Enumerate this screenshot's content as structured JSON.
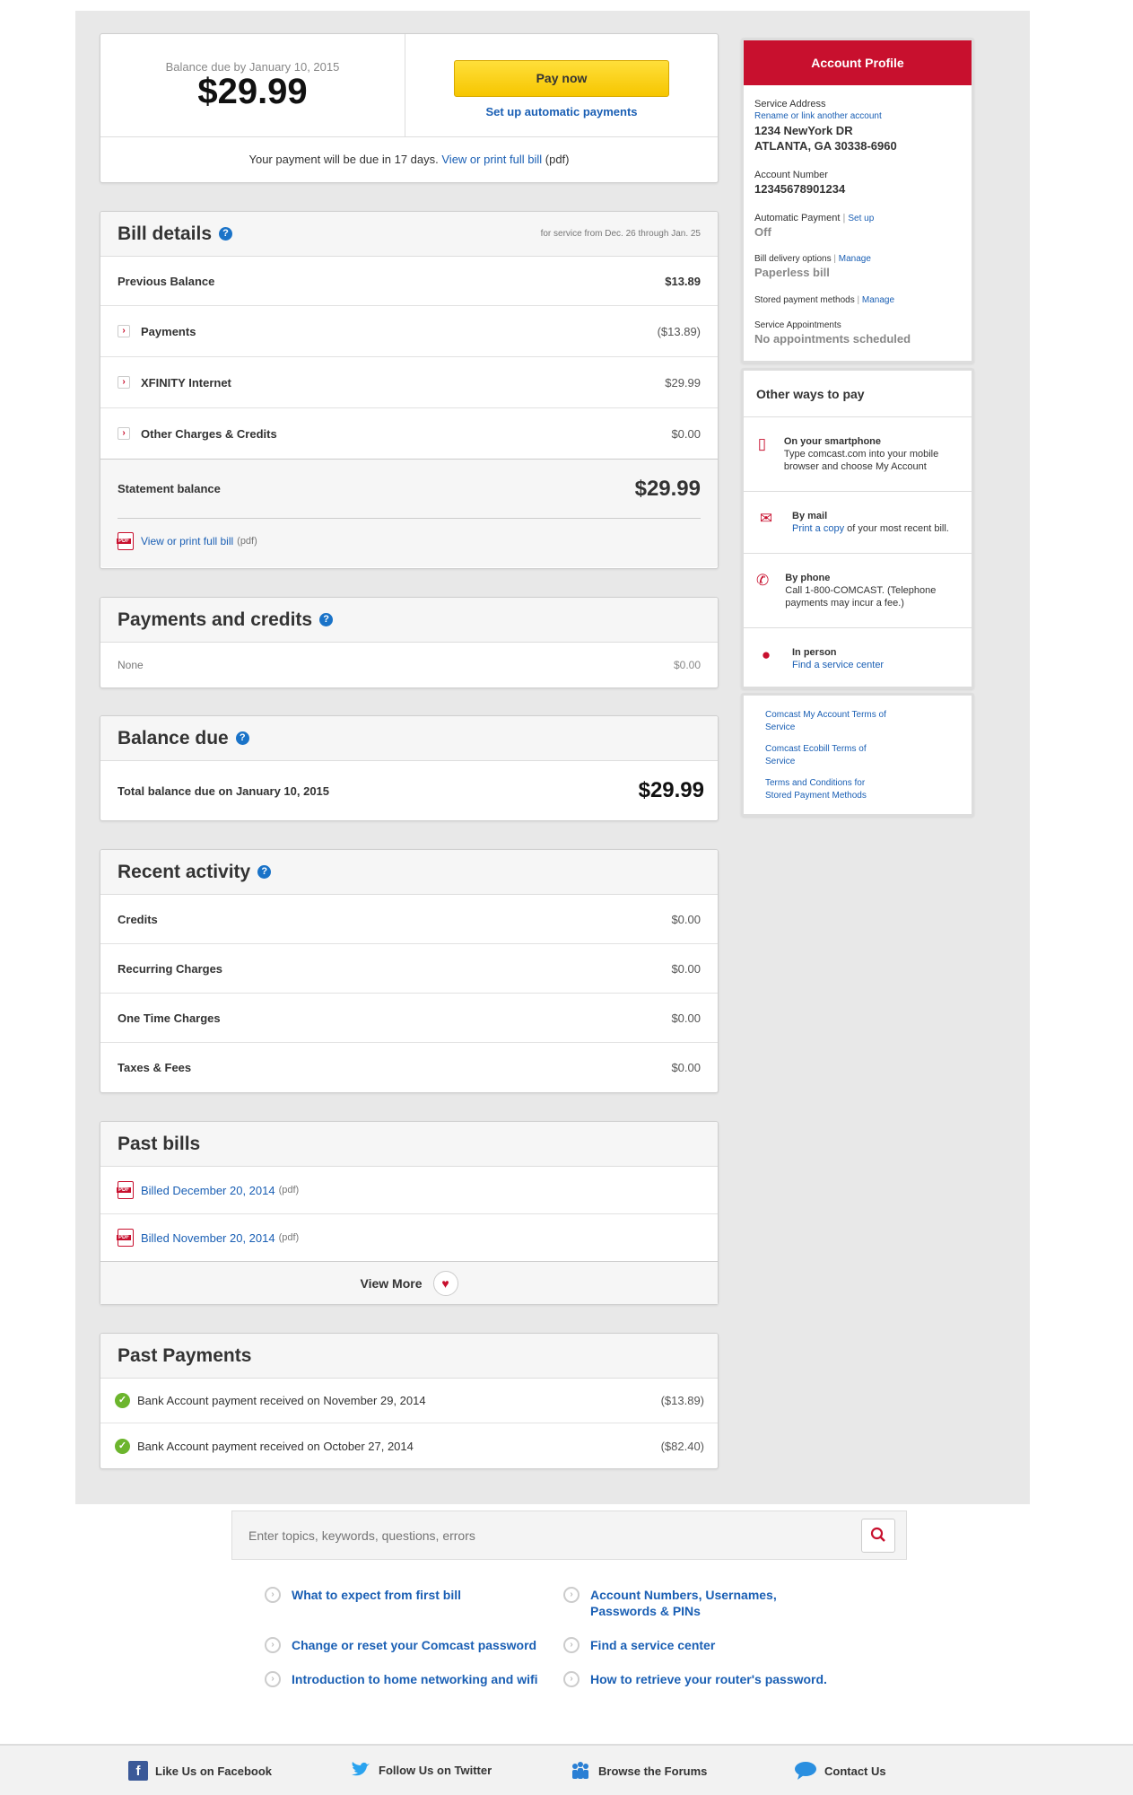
{
  "summary": {
    "balance_due_label": "Balance due by January 10, 2015",
    "balance_amount": "$29.99",
    "pay_now": "Pay now",
    "setup_auto": "Set up automatic payments",
    "due_notice": "Your payment will be due in 17 days.",
    "view_print": "View or print full bill",
    "pdf": "(pdf)"
  },
  "bill_details": {
    "title": "Bill details",
    "period": "for service from Dec. 26 through Jan. 25",
    "previous_balance_label": "Previous Balance",
    "previous_balance": "$13.89",
    "items": [
      {
        "label": "Payments",
        "amount": "($13.89)"
      },
      {
        "label": "XFINITY Internet",
        "amount": "$29.99"
      },
      {
        "label": "Other Charges & Credits",
        "amount": "$0.00"
      }
    ],
    "statement_label": "Statement balance",
    "statement_amount": "$29.99",
    "view_print": "View or print full bill",
    "pdf": "(pdf)"
  },
  "payments_credits": {
    "title": "Payments and credits",
    "label": "None",
    "amount": "$0.00"
  },
  "balance_due": {
    "title": "Balance due",
    "label": "Total balance due on January 10, 2015",
    "amount": "$29.99"
  },
  "recent_activity": {
    "title": "Recent activity",
    "items": [
      {
        "label": "Credits",
        "amount": "$0.00"
      },
      {
        "label": "Recurring Charges",
        "amount": "$0.00"
      },
      {
        "label": "One Time Charges",
        "amount": "$0.00"
      },
      {
        "label": "Taxes & Fees",
        "amount": "$0.00"
      }
    ]
  },
  "past_bills": {
    "title": "Past bills",
    "items": [
      {
        "label": "Billed December 20, 2014",
        "pdf": "(pdf)"
      },
      {
        "label": "Billed November 20, 2014",
        "pdf": "(pdf)"
      }
    ],
    "view_more": "View More"
  },
  "past_payments": {
    "title": "Past Payments",
    "items": [
      {
        "label": "Bank Account payment received on November 29, 2014",
        "amount": "($13.89)"
      },
      {
        "label": "Bank Account payment received on October 27, 2014",
        "amount": "($82.40)"
      }
    ]
  },
  "profile": {
    "title": "Account Profile",
    "service_address_label": "Service Address",
    "rename_link": "Rename or link another account",
    "address_line1": "1234 NewYork DR",
    "address_line2": "ATLANTA, GA 30338-6960",
    "account_number_label": "Account Number",
    "account_number": "12345678901234",
    "auto_payment_label": "Automatic Payment",
    "sep": "|",
    "setup": "Set up",
    "auto_payment_value": "Off",
    "bill_delivery_label": "Bill delivery options",
    "manage": "Manage",
    "bill_delivery_value": "Paperless bill",
    "stored_label": "Stored payment methods",
    "appointments_label": "Service Appointments",
    "appointments_value": "No appointments scheduled"
  },
  "other_ways": {
    "title": "Other ways to pay",
    "smartphone_title": "On your smartphone",
    "smartphone_text": "Type comcast.com into your mobile browser and choose My Account",
    "mail_title": "By mail",
    "mail_link": "Print a copy",
    "mail_text": "of your most recent bill.",
    "phone_title": "By phone",
    "phone_text": "Call 1-800-COMCAST. (Telephone payments may incur a fee.)",
    "person_title": "In person",
    "person_link": "Find a service center"
  },
  "terms": [
    "Comcast My Account Terms of Service",
    "Comcast Ecobill Terms of Service",
    "Terms and Conditions for Stored Payment Methods"
  ],
  "search": {
    "placeholder": "Enter topics, keywords, questions, errors"
  },
  "help_links": [
    "What to expect from first bill",
    "Account Numbers, Usernames, Passwords & PINs",
    "Change or reset your Comcast password",
    "Find a service center",
    "Introduction to home networking and wifi",
    "How to retrieve your router's password."
  ],
  "footer": {
    "facebook": "Like Us on Facebook",
    "twitter": "Follow Us on Twitter",
    "forums": "Browse the Forums",
    "contact": "Contact Us"
  },
  "colors": {
    "brand_red": "#c8102e",
    "link_blue": "#1a5fb4",
    "pay_yellow": "#ffd200"
  }
}
